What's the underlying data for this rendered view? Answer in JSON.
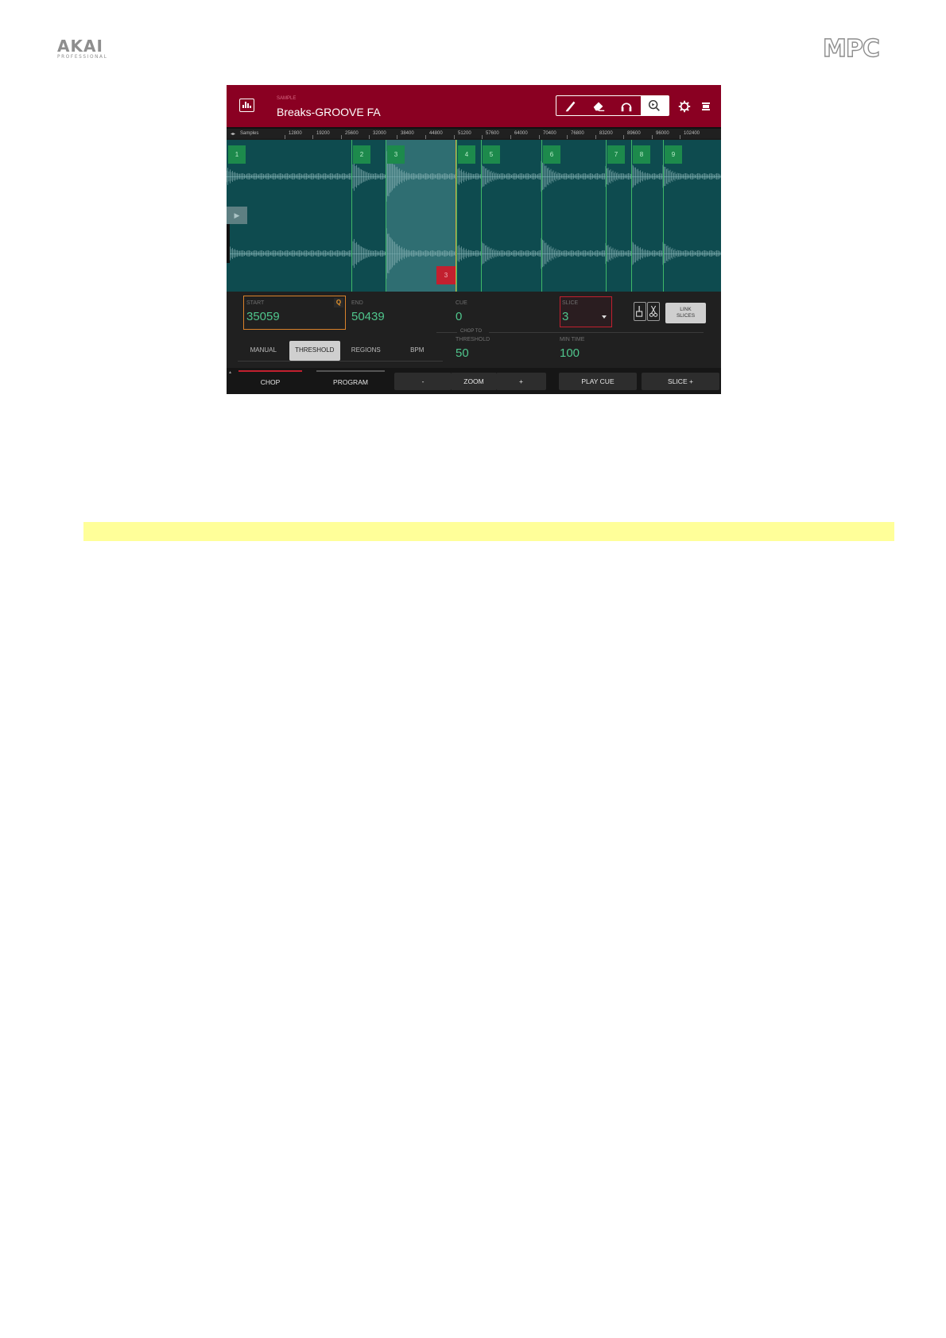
{
  "logos": {
    "akai": "AKAI",
    "akai_sub": "PROFESSIONAL",
    "mpc": "MPC"
  },
  "header": {
    "sample_sub": "SAMPLE",
    "sample_name": "Breaks-GROOVE FA"
  },
  "toolbar": {
    "tools": [
      "pencil-icon",
      "eraser-icon",
      "headphones-icon",
      "zoom-icon"
    ],
    "active_tool": "zoom-icon"
  },
  "ruler": {
    "unit_label": "Samples",
    "ticks": [
      "12800",
      "19200",
      "25600",
      "32000",
      "38400",
      "44800",
      "51200",
      "57600",
      "64000",
      "70400",
      "76800",
      "83200",
      "89600",
      "96000",
      "102400"
    ]
  },
  "slices": [
    "1",
    "2",
    "3",
    "4",
    "5",
    "6",
    "7",
    "8",
    "9"
  ],
  "end_marker": "3",
  "params": {
    "start_label": "START",
    "start_value": "35059",
    "q_badge": "Q",
    "end_label": "END",
    "end_value": "50439",
    "cue_label": "CUE",
    "cue_value": "0",
    "slice_label": "SLICE",
    "slice_value": "3",
    "link_label_1": "LINK",
    "link_label_2": "SLICES",
    "chop_to": "CHOP TO",
    "threshold_label": "THRESHOLD",
    "threshold_value": "50",
    "min_time_label": "MIN TIME",
    "min_time_value": "100"
  },
  "chop_modes": [
    "MANUAL",
    "THRESHOLD",
    "REGIONS",
    "BPM"
  ],
  "active_chop_mode": "THRESHOLD",
  "bottom": {
    "chop": "CHOP",
    "program": "PROGRAM",
    "zoom_minus": "-",
    "zoom": "ZOOM",
    "zoom_plus": "+",
    "play_cue": "PLAY CUE",
    "slice_plus": "SLICE +"
  },
  "colors": {
    "header": "#8a0022",
    "waveform_bg": "#0e4b4f",
    "slice_green": "#1d8a4c",
    "value_green": "#4fc58c",
    "accent_red": "#c2202f",
    "highlight": "#ffff99"
  }
}
